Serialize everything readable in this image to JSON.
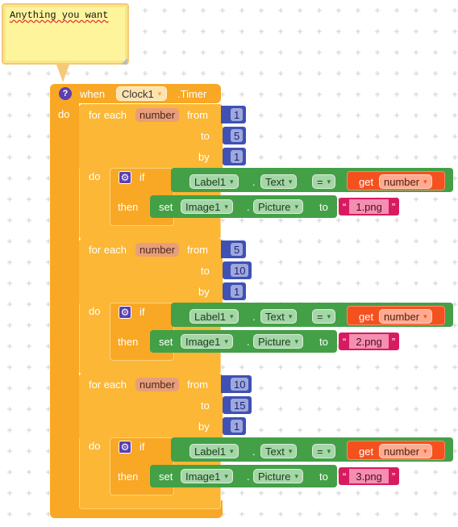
{
  "comment": {
    "text": "Anything you want"
  },
  "event": {
    "help_label": "?",
    "when_label": "when",
    "component": "Clock1",
    "event_name": ".Timer",
    "do_label": "do"
  },
  "loops": [
    {
      "for_each_label": "for each",
      "variable": "number",
      "from_label": "from",
      "from_value": "1",
      "to_label": "to",
      "to_value": "5",
      "by_label": "by",
      "by_value": "1",
      "do_label": "do",
      "if": {
        "if_label": "if",
        "then_label": "then",
        "left_component": "Label1",
        "left_property": "Text",
        "operator": "=",
        "get_label": "get",
        "get_variable": "number",
        "set_label": "set",
        "set_component": "Image1",
        "set_property": "Picture",
        "to_label": "to",
        "string_value": "1.png"
      }
    },
    {
      "for_each_label": "for each",
      "variable": "number",
      "from_label": "from",
      "from_value": "5",
      "to_label": "to",
      "to_value": "10",
      "by_label": "by",
      "by_value": "1",
      "do_label": "do",
      "if": {
        "if_label": "if",
        "then_label": "then",
        "left_component": "Label1",
        "left_property": "Text",
        "operator": "=",
        "get_label": "get",
        "get_variable": "number",
        "set_label": "set",
        "set_component": "Image1",
        "set_property": "Picture",
        "to_label": "to",
        "string_value": "2.png"
      }
    },
    {
      "for_each_label": "for each",
      "variable": "number",
      "from_label": "from",
      "from_value": "10",
      "to_label": "to",
      "to_value": "15",
      "by_label": "by",
      "by_value": "1",
      "do_label": "do",
      "if": {
        "if_label": "if",
        "then_label": "then",
        "left_component": "Label1",
        "left_property": "Text",
        "operator": "=",
        "get_label": "get",
        "get_variable": "number",
        "set_label": "set",
        "set_component": "Image1",
        "set_property": "Picture",
        "to_label": "to",
        "string_value": "3.png"
      }
    }
  ],
  "glyphs": {
    "dropdown": "▾",
    "quote_open": "“",
    "quote_close": "”",
    "gear": "⚙"
  },
  "colors": {
    "event": "#f9a825",
    "math": "#3f51b5",
    "component": "#43a047",
    "variable": "#f4511e",
    "text": "#d81b60",
    "comment": "#fef49c"
  }
}
